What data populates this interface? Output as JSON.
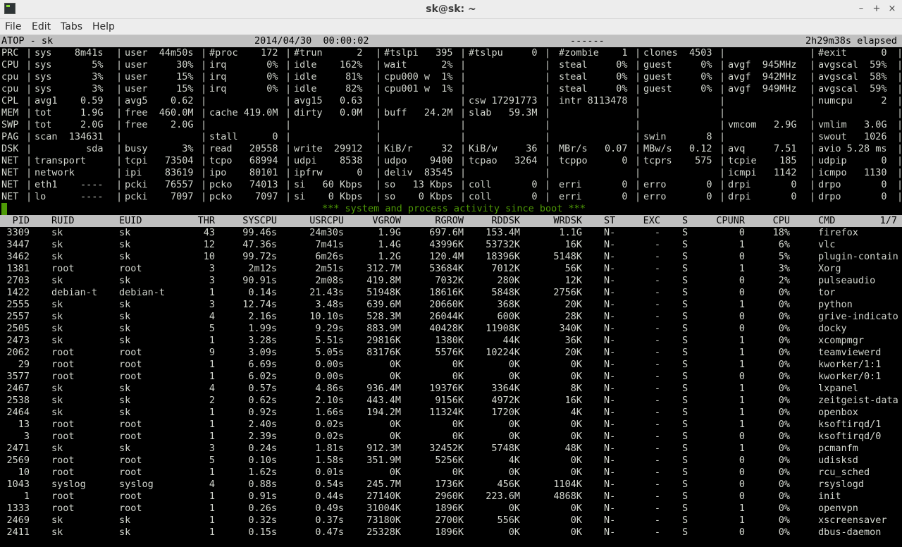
{
  "window": {
    "title": "sk@sk: ~",
    "controls": {
      "minimize": "–",
      "maximize": "+",
      "close": "×"
    }
  },
  "menu": [
    "File",
    "Edit",
    "Tabs",
    "Help"
  ],
  "atop": {
    "header": {
      "left": "ATOP - sk",
      "datetime": "2014/04/30  00:00:02",
      "middle": "------",
      "right": "2h29m38s elapsed"
    },
    "system_lines": [
      [
        "PRC",
        "sys    8m41s",
        "user  44m50s",
        "#proc    172",
        "#trun      2",
        "#tslpi   395",
        "#tslpu     0",
        "#zombie    1",
        "clones  4503",
        "",
        "#exit      0"
      ],
      [
        "CPU",
        "sys       5%",
        "user     30%",
        "irq       0%",
        "idle    162%",
        "wait      2%",
        "",
        "steal     0%",
        "guest     0%",
        "avgf  945MHz",
        "avgscal  59%"
      ],
      [
        "cpu",
        "sys       3%",
        "user     15%",
        "irq       0%",
        "idle     81%",
        "cpu000 w  1%",
        "",
        "steal     0%",
        "guest     0%",
        "avgf  942MHz",
        "avgscal  58%"
      ],
      [
        "cpu",
        "sys       3%",
        "user     15%",
        "irq       0%",
        "idle     82%",
        "cpu001 w  1%",
        "",
        "steal     0%",
        "guest     0%",
        "avgf  949MHz",
        "avgscal  59%"
      ],
      [
        "CPL",
        "avg1    0.59",
        "avg5    0.62",
        "",
        "avg15   0.63",
        "",
        "csw 17291773",
        "intr 8113478",
        "",
        "",
        "numcpu     2"
      ],
      [
        "MEM",
        "tot     1.9G",
        "free  460.0M",
        "cache 419.0M",
        "dirty   0.0M",
        "buff   24.2M",
        "slab   59.3M",
        "",
        "",
        "",
        ""
      ],
      [
        "SWP",
        "tot     2.0G",
        "free    2.0G",
        "",
        "",
        "",
        "",
        "",
        "",
        "vmcom   2.9G",
        "vmlim   3.0G"
      ],
      [
        "PAG",
        "scan  134631",
        "",
        "stall      0",
        "",
        "",
        "",
        "",
        "swin       8",
        "",
        "swout   1026"
      ],
      [
        "DSK",
        "         sda",
        "busy      3%",
        "read   20558",
        "write  29912",
        "KiB/r     32",
        "KiB/w     36",
        "MBr/s   0.07",
        "MBw/s   0.12",
        "avq     7.51",
        "avio 5.28 ms"
      ],
      [
        "NET",
        "transport",
        "tcpi   73504",
        "tcpo   68994",
        "udpi    8538",
        "udpo    9400",
        "tcpao   3264",
        "tcppo      0",
        "tcprs    575",
        "tcpie    185",
        "udpip      0"
      ],
      [
        "NET",
        "network",
        "ipi    83619",
        "ipo    80101",
        "ipfrw      0",
        "deliv  83545",
        "",
        "",
        "",
        "icmpi   1142",
        "icmpo   1130"
      ],
      [
        "NET",
        "eth1    ----",
        "pcki   76557",
        "pcko   74013",
        "si   60 Kbps",
        "so   13 Kbps",
        "coll       0",
        "erri       0",
        "erro       0",
        "drpi       0",
        "drpo       0"
      ],
      [
        "NET",
        "lo      ----",
        "pcki    7097",
        "pcko    7097",
        "si    0 Kbps",
        "so    0 Kbps",
        "coll       0",
        "erri       0",
        "erro       0",
        "drpi       0",
        "drpo       0"
      ]
    ],
    "banner": "*** system and process activity since boot ***",
    "process_header": [
      "PID",
      "RUID",
      "EUID",
      "THR",
      "SYSCPU",
      "USRCPU",
      "VGROW",
      "RGROW",
      "RDDSK",
      "WRDSK",
      "ST",
      "EXC",
      "S",
      "CPUNR",
      "CPU",
      "CMD",
      "1/7"
    ],
    "processes": [
      [
        "3309",
        "sk",
        "sk",
        "43",
        "99.46s",
        "24m30s",
        "1.9G",
        "697.6M",
        "153.4M",
        "1.1G",
        "N-",
        "-",
        "S",
        "0",
        "18%",
        "firefox"
      ],
      [
        "3447",
        "sk",
        "sk",
        "12",
        "47.36s",
        "7m41s",
        "1.4G",
        "43996K",
        "53732K",
        "16K",
        "N-",
        "-",
        "S",
        "1",
        "6%",
        "vlc"
      ],
      [
        "3462",
        "sk",
        "sk",
        "10",
        "99.72s",
        "6m26s",
        "1.2G",
        "120.4M",
        "18396K",
        "5148K",
        "N-",
        "-",
        "S",
        "0",
        "5%",
        "plugin-contain"
      ],
      [
        "1381",
        "root",
        "root",
        "3",
        "2m12s",
        "2m51s",
        "312.7M",
        "53684K",
        "7012K",
        "56K",
        "N-",
        "-",
        "S",
        "1",
        "3%",
        "Xorg"
      ],
      [
        "2703",
        "sk",
        "sk",
        "3",
        "90.91s",
        "2m08s",
        "419.8M",
        "7032K",
        "280K",
        "12K",
        "N-",
        "-",
        "S",
        "0",
        "2%",
        "pulseaudio"
      ],
      [
        "1422",
        "debian-t",
        "debian-t",
        "1",
        "0.14s",
        "21.43s",
        "51948K",
        "18616K",
        "5848K",
        "2756K",
        "N-",
        "-",
        "S",
        "0",
        "0%",
        "tor"
      ],
      [
        "2555",
        "sk",
        "sk",
        "3",
        "12.74s",
        "3.48s",
        "639.6M",
        "20660K",
        "368K",
        "20K",
        "N-",
        "-",
        "S",
        "1",
        "0%",
        "python"
      ],
      [
        "2557",
        "sk",
        "sk",
        "4",
        "2.16s",
        "10.10s",
        "528.3M",
        "26044K",
        "600K",
        "28K",
        "N-",
        "-",
        "S",
        "0",
        "0%",
        "grive-indicato"
      ],
      [
        "2505",
        "sk",
        "sk",
        "5",
        "1.99s",
        "9.29s",
        "883.9M",
        "40428K",
        "11908K",
        "340K",
        "N-",
        "-",
        "S",
        "0",
        "0%",
        "docky"
      ],
      [
        "2473",
        "sk",
        "sk",
        "1",
        "3.28s",
        "5.51s",
        "29816K",
        "1380K",
        "44K",
        "36K",
        "N-",
        "-",
        "S",
        "1",
        "0%",
        "xcompmgr"
      ],
      [
        "2062",
        "root",
        "root",
        "9",
        "3.09s",
        "5.05s",
        "83176K",
        "5576K",
        "10224K",
        "20K",
        "N-",
        "-",
        "S",
        "1",
        "0%",
        "teamviewerd"
      ],
      [
        "29",
        "root",
        "root",
        "1",
        "6.69s",
        "0.00s",
        "0K",
        "0K",
        "0K",
        "0K",
        "N-",
        "-",
        "S",
        "1",
        "0%",
        "kworker/1:1"
      ],
      [
        "3577",
        "root",
        "root",
        "1",
        "6.02s",
        "0.00s",
        "0K",
        "0K",
        "0K",
        "0K",
        "N-",
        "-",
        "S",
        "0",
        "0%",
        "kworker/0:1"
      ],
      [
        "2467",
        "sk",
        "sk",
        "4",
        "0.57s",
        "4.86s",
        "936.4M",
        "19376K",
        "3364K",
        "8K",
        "N-",
        "-",
        "S",
        "1",
        "0%",
        "lxpanel"
      ],
      [
        "2538",
        "sk",
        "sk",
        "2",
        "0.62s",
        "2.10s",
        "443.4M",
        "9156K",
        "4972K",
        "16K",
        "N-",
        "-",
        "S",
        "1",
        "0%",
        "zeitgeist-data"
      ],
      [
        "2464",
        "sk",
        "sk",
        "1",
        "0.92s",
        "1.66s",
        "194.2M",
        "11324K",
        "1720K",
        "4K",
        "N-",
        "-",
        "S",
        "1",
        "0%",
        "openbox"
      ],
      [
        "13",
        "root",
        "root",
        "1",
        "2.40s",
        "0.02s",
        "0K",
        "0K",
        "0K",
        "0K",
        "N-",
        "-",
        "S",
        "1",
        "0%",
        "ksoftirqd/1"
      ],
      [
        "3",
        "root",
        "root",
        "1",
        "2.39s",
        "0.02s",
        "0K",
        "0K",
        "0K",
        "0K",
        "N-",
        "-",
        "S",
        "0",
        "0%",
        "ksoftirqd/0"
      ],
      [
        "2471",
        "sk",
        "sk",
        "3",
        "0.24s",
        "1.81s",
        "912.3M",
        "32452K",
        "5748K",
        "48K",
        "N-",
        "-",
        "S",
        "1",
        "0%",
        "pcmanfm"
      ],
      [
        "2569",
        "root",
        "root",
        "5",
        "0.10s",
        "1.58s",
        "351.9M",
        "5256K",
        "4K",
        "0K",
        "N-",
        "-",
        "S",
        "0",
        "0%",
        "udisksd"
      ],
      [
        "10",
        "root",
        "root",
        "1",
        "1.62s",
        "0.01s",
        "0K",
        "0K",
        "0K",
        "0K",
        "N-",
        "-",
        "S",
        "0",
        "0%",
        "rcu_sched"
      ],
      [
        "1043",
        "syslog",
        "syslog",
        "4",
        "0.88s",
        "0.54s",
        "245.7M",
        "1736K",
        "456K",
        "1104K",
        "N-",
        "-",
        "S",
        "0",
        "0%",
        "rsyslogd"
      ],
      [
        "1",
        "root",
        "root",
        "1",
        "0.91s",
        "0.44s",
        "27140K",
        "2960K",
        "223.6M",
        "4868K",
        "N-",
        "-",
        "S",
        "0",
        "0%",
        "init"
      ],
      [
        "1333",
        "root",
        "root",
        "1",
        "0.26s",
        "0.49s",
        "31004K",
        "1896K",
        "0K",
        "0K",
        "N-",
        "-",
        "S",
        "1",
        "0%",
        "openvpn"
      ],
      [
        "2469",
        "sk",
        "sk",
        "1",
        "0.32s",
        "0.37s",
        "73180K",
        "2700K",
        "556K",
        "0K",
        "N-",
        "-",
        "S",
        "1",
        "0%",
        "xscreensaver"
      ],
      [
        "2411",
        "sk",
        "sk",
        "1",
        "0.15s",
        "0.47s",
        "25328K",
        "1896K",
        "0K",
        "0K",
        "N-",
        "-",
        "S",
        "0",
        "0%",
        "dbus-daemon"
      ]
    ]
  },
  "colors": {
    "terminal_bg": "#000000",
    "terminal_fg": "#d3d7cf",
    "header_bar": "#c0c0c0",
    "banner_green": "#4e9a06",
    "chrome": "#ededed"
  }
}
